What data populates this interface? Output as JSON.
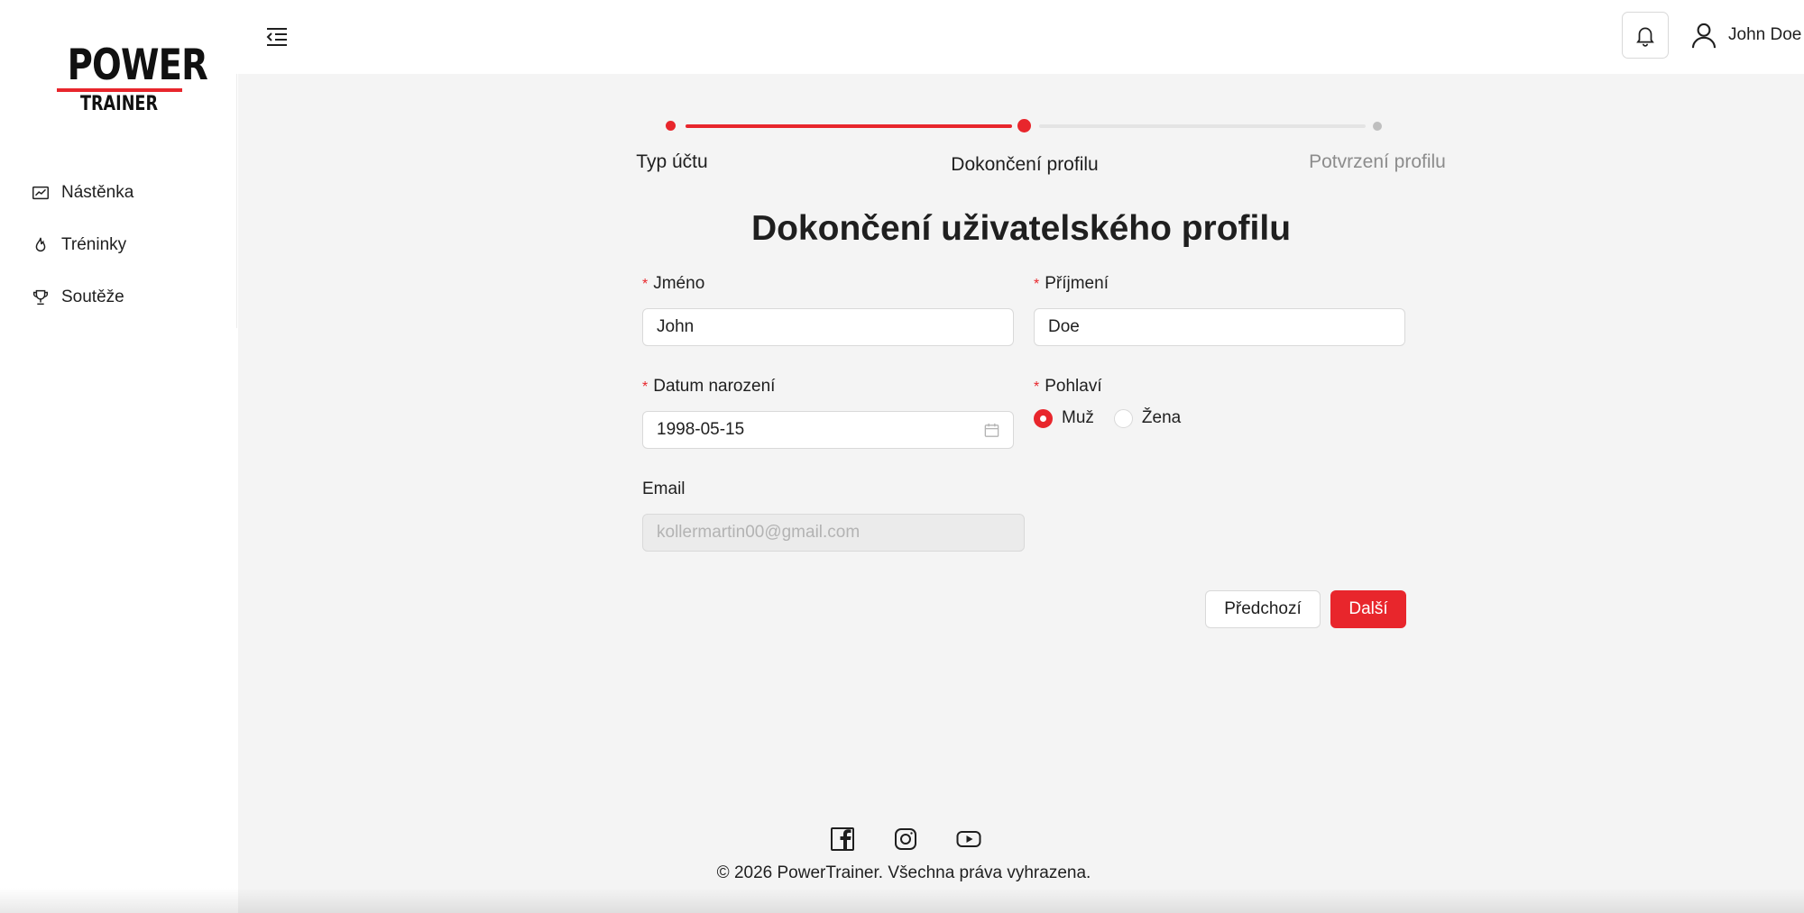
{
  "brand": {
    "logo_top": "POWER",
    "logo_bottom": "TRAINER",
    "accent_color": "#e8262c"
  },
  "sidebar": {
    "items": [
      {
        "label": "Nástěnka",
        "icon": "chart-line-icon"
      },
      {
        "label": "Tréninky",
        "icon": "flame-icon"
      },
      {
        "label": "Soutěže",
        "icon": "trophy-icon"
      }
    ]
  },
  "header": {
    "menu_icon": "menu-fold-icon",
    "bell_icon": "bell-icon",
    "user_name": "John Doe"
  },
  "steps": [
    {
      "label": "Typ účtu",
      "state": "done"
    },
    {
      "label": "Dokončení profilu",
      "state": "current"
    },
    {
      "label": "Potvrzení profilu",
      "state": "pending"
    }
  ],
  "form": {
    "title": "Dokončení uživatelského profilu",
    "required_mark": "*",
    "first_name": {
      "label": "Jméno",
      "value": "John"
    },
    "last_name": {
      "label": "Příjmení",
      "value": "Doe"
    },
    "birth_date": {
      "label": "Datum narození",
      "value": "1998-05-15"
    },
    "gender": {
      "label": "Pohlaví",
      "options": [
        "Muž",
        "Žena"
      ],
      "selected": "Muž"
    },
    "email": {
      "label": "Email",
      "value": "kollermartin00@gmail.com",
      "disabled": true
    },
    "prev_label": "Předchozí",
    "next_label": "Další"
  },
  "footer": {
    "social_icons": [
      "facebook-icon",
      "instagram-icon",
      "youtube-icon"
    ],
    "copyright": "© 2026 PowerTrainer. Všechna práva vyhrazena."
  }
}
